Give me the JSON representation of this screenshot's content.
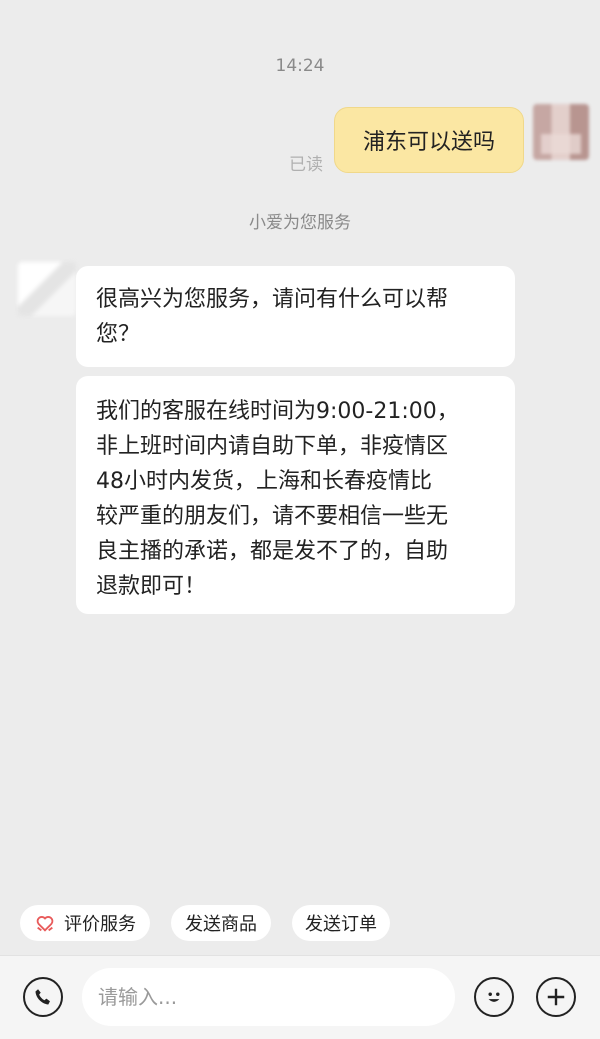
{
  "chat": {
    "timestamp": "14:24",
    "outgoing": {
      "text": "浦东可以送吗",
      "status": "已读"
    },
    "service_note": "小爱为您服务",
    "incoming": [
      "很高兴为您服务，请问有什么可以帮\n您？",
      "我们的客服在线时间为9:00-21:00，\n非上班时间内请自助下单，非疫情区\n48小时内发货，上海和长春疫情比\n较严重的朋友们，请不要相信一些无\n良主播的承诺，都是发不了的，自助\n退款即可！"
    ]
  },
  "quick_actions": {
    "rate_service": "评价服务",
    "send_product": "发送商品",
    "send_order": "发送订单"
  },
  "composer": {
    "placeholder": "请输入..."
  },
  "icons": {
    "rate": "heart-hands-icon",
    "phone": "phone-icon",
    "emoji": "emoji-icon",
    "plus": "plus-icon"
  },
  "colors": {
    "outgoing_bubble": "#fbe7a3",
    "rate_icon": "#e85a5a"
  }
}
